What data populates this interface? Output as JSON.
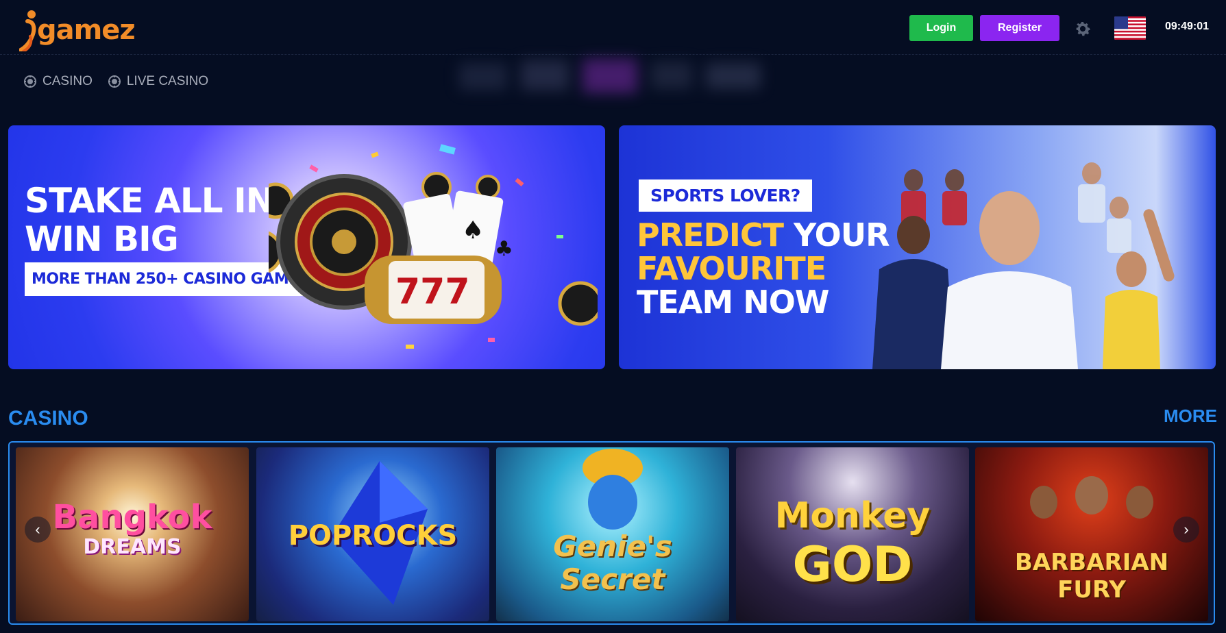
{
  "brand": {
    "logo_text": "gamez",
    "logo_alt": "igamez"
  },
  "header": {
    "login_label": "Login",
    "register_label": "Register",
    "clock": "09:49:01",
    "flag": "us-flag-icon",
    "settings_icon": "gear-icon"
  },
  "nav": {
    "items": [
      {
        "label": "CASINO",
        "icon": "chip-icon"
      },
      {
        "label": "LIVE CASINO",
        "icon": "chip-icon"
      }
    ]
  },
  "banners": [
    {
      "headline_line1": "STAKE ALL IN ,",
      "headline_line2": "WIN BIG",
      "tag": "MORE THAN 250+ CASINO GAMES"
    },
    {
      "tag": "SPORTS LOVER?",
      "line1_yellow": "PREDICT",
      "line1_white": " YOUR",
      "line2_yellow": "FAVOURITE",
      "line3_white": "TEAM NOW"
    }
  ],
  "casino_section": {
    "title": "CASINO",
    "more_label": "MORE",
    "games": [
      {
        "title_line1": "Bangkok",
        "title_line2": "DREAMS"
      },
      {
        "title_line1": "POPROCKS",
        "title_line2": ""
      },
      {
        "title_line1": "Genie's",
        "title_line2": "Secret"
      },
      {
        "title_line1": "Monkey",
        "title_line2": "GOD"
      },
      {
        "title_line1": "BARBARIAN",
        "title_line2": "FURY"
      }
    ]
  },
  "colors": {
    "background": "#050d22",
    "accent": "#2a8cf0",
    "login_green": "#1fba4c",
    "register_purple": "#8b25f0",
    "brand_orange": "#f28c28",
    "banner_yellow": "#ffc63a"
  }
}
